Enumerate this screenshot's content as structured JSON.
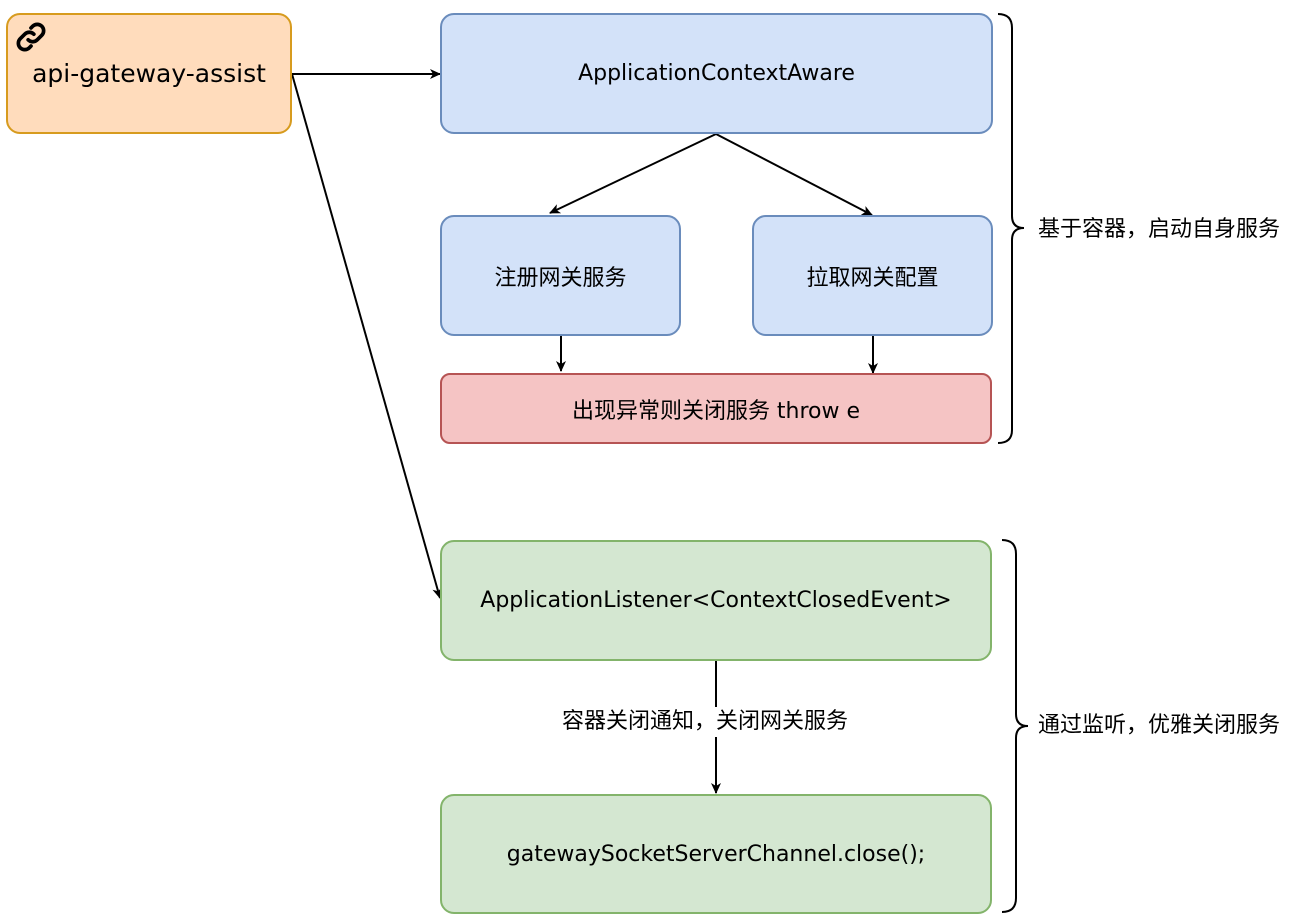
{
  "nodes": {
    "assist": "api-gateway-assist",
    "context_aware": "ApplicationContextAware",
    "register": "注册网关服务",
    "pull_config": "拉取网关配置",
    "exception": "出现异常则关闭服务 throw e",
    "listener": "ApplicationListener<ContextClosedEvent>",
    "close_call": "gatewaySocketServerChannel.close();"
  },
  "edge_labels": {
    "close_notice": "容器关闭通知，关闭网关服务"
  },
  "brace_labels": {
    "startup": "基于容器，启动自身服务",
    "shutdown": "通过监听，优雅关闭服务"
  },
  "icons": {
    "assist_icon": "link-icon"
  },
  "colors": {
    "orange_fill": "#ffdcbc",
    "blue_fill": "#d3e2f9",
    "red_fill": "#f5c4c4",
    "green_fill": "#d4e7d1"
  }
}
